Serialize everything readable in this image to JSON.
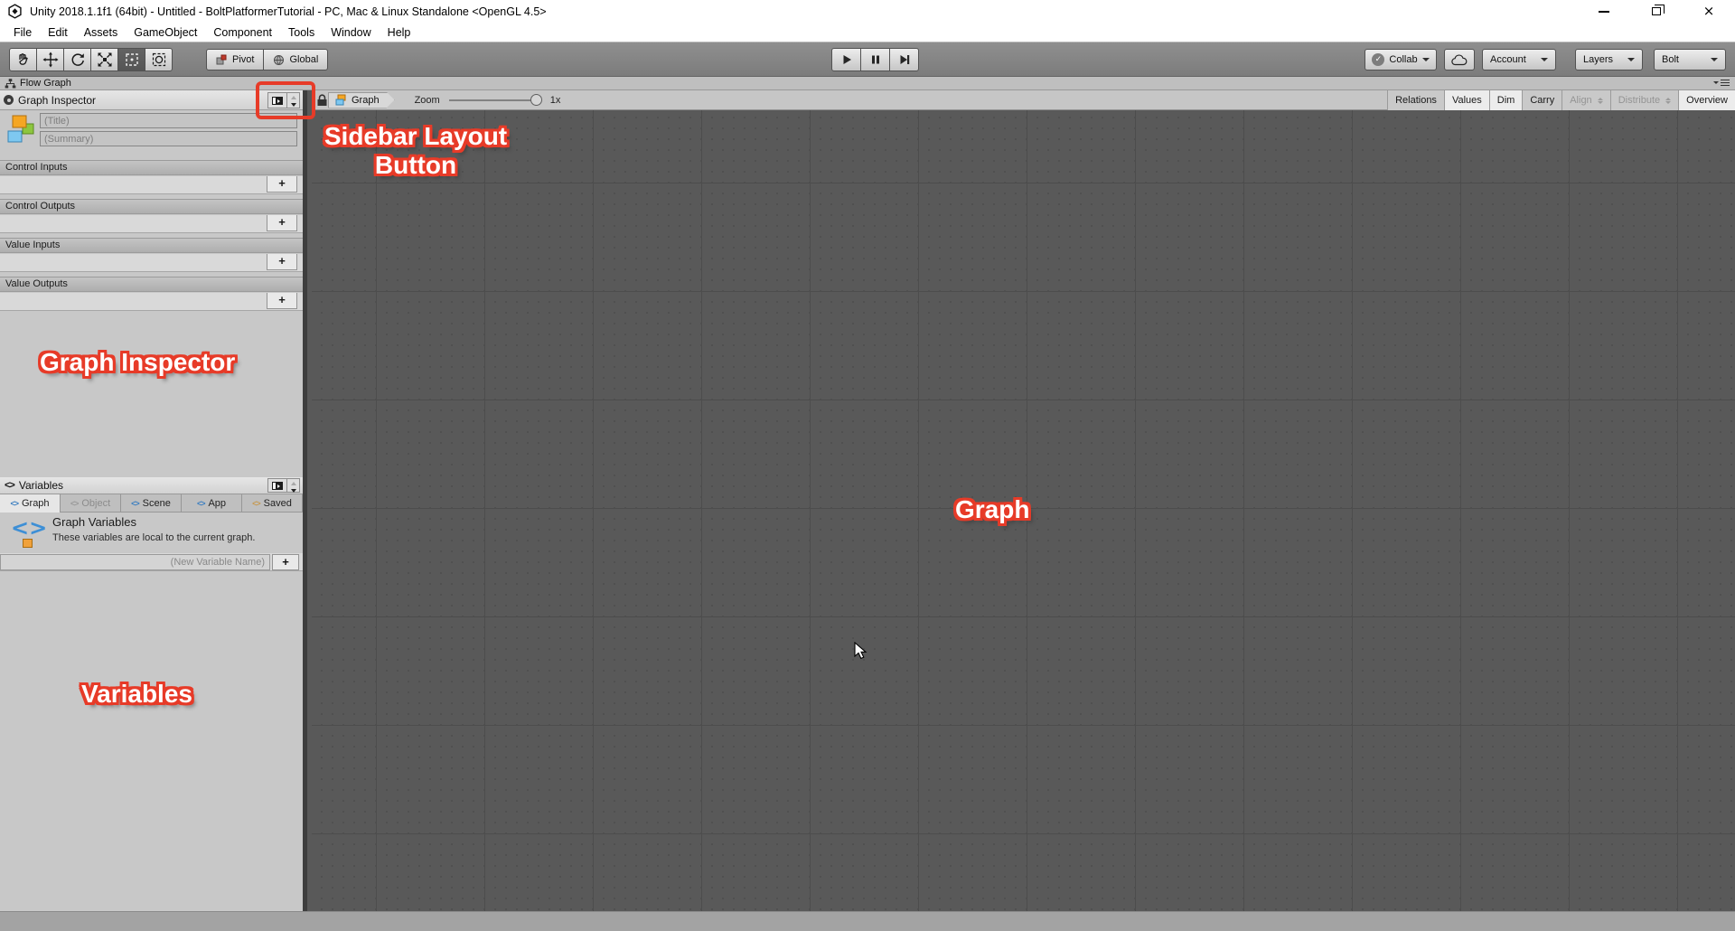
{
  "window": {
    "title": "Unity 2018.1.1f1 (64bit) - Untitled - BoltPlatformerTutorial - PC, Mac & Linux Standalone <OpenGL 4.5>"
  },
  "menu": {
    "items": [
      {
        "label": "File"
      },
      {
        "label": "Edit"
      },
      {
        "label": "Assets"
      },
      {
        "label": "GameObject"
      },
      {
        "label": "Component"
      },
      {
        "label": "Tools"
      },
      {
        "label": "Window"
      },
      {
        "label": "Help"
      }
    ]
  },
  "toolbar": {
    "pivot": "Pivot",
    "global": "Global",
    "collab": "Collab",
    "collab_check": "✓",
    "account": "Account",
    "layers": "Layers",
    "bolt": "Bolt"
  },
  "tabbar": {
    "title": "Flow Graph"
  },
  "inspector": {
    "header": "Graph Inspector",
    "title_placeholder": "(Title)",
    "summary_placeholder": "(Summary)",
    "add_label": "+",
    "sections": [
      {
        "label": "Control Inputs"
      },
      {
        "label": "Control Outputs"
      },
      {
        "label": "Value Inputs"
      },
      {
        "label": "Value Outputs"
      }
    ]
  },
  "variables": {
    "glyph": "<>",
    "header": "Variables",
    "tabs": [
      {
        "label": "Graph"
      },
      {
        "label": "Object"
      },
      {
        "label": "Scene"
      },
      {
        "label": "App"
      },
      {
        "label": "Saved"
      }
    ],
    "info_title": "Graph Variables",
    "info_desc": "These variables are local to the current graph.",
    "new_placeholder": "(New Variable Name)",
    "add_label": "+"
  },
  "graph": {
    "breadcrumb": "Graph",
    "zoom_label": "Zoom",
    "zoom_value": "1x",
    "buttons": [
      {
        "label": "Relations"
      },
      {
        "label": "Values"
      },
      {
        "label": "Dim"
      },
      {
        "label": "Carry"
      },
      {
        "label": "Align"
      },
      {
        "label": "Distribute"
      },
      {
        "label": "Overview"
      }
    ]
  },
  "annotations": {
    "sidebar_line1": "Sidebar Layout",
    "sidebar_line2": "Button",
    "inspector_label": "Graph Inspector",
    "variables_label": "Variables",
    "graph_label": "Graph"
  },
  "colors": {
    "annotation_red": "#e73b28",
    "canvas_bg": "#595959",
    "sidebar_bg": "#c8c8c8",
    "statusbar_bg": "#a3a3a3"
  }
}
